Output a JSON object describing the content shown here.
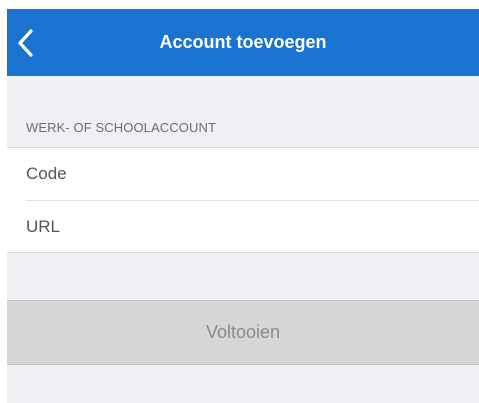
{
  "colors": {
    "nav_bar": "#1a73d1",
    "nav_text": "#ffffff",
    "background": "#efeff4",
    "button_disabled_bg": "#d6d6d6",
    "button_disabled_text": "#8a8a8a"
  },
  "navbar": {
    "back_icon": "chevron-left-icon",
    "title": "Account toevoegen"
  },
  "section": {
    "header": "WERK- OF SCHOOLACCOUNT"
  },
  "form": {
    "code": {
      "value": "",
      "placeholder": "Code"
    },
    "url": {
      "value": "",
      "placeholder": "URL"
    }
  },
  "actions": {
    "done_label": "Voltooien",
    "done_enabled": false
  }
}
